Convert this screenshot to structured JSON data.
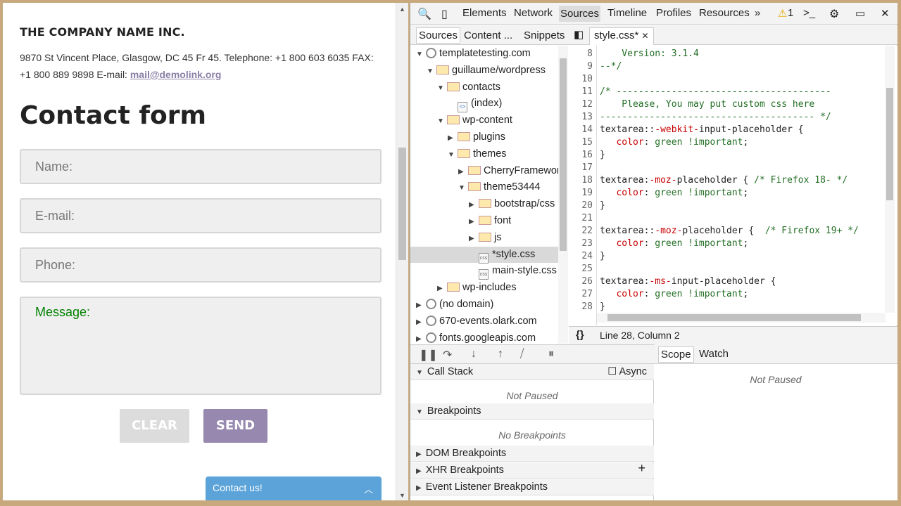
{
  "page": {
    "company": "THE COMPANY NAME INC.",
    "address": "9870 St Vincent Place, Glasgow, DC 45 Fr 45. Telephone: +1 800 603 6035 FAX: +1 800 889 9898 E-mail: ",
    "email": "mail@demolink.org",
    "form_title": "Contact form",
    "name_placeholder": "Name:",
    "email_placeholder": "E-mail:",
    "phone_placeholder": "Phone:",
    "message_placeholder": "Message:",
    "clear_label": "CLEAR",
    "send_label": "SEND",
    "chat_label": "Contact us!"
  },
  "devtools": {
    "tabs": [
      "Elements",
      "Network",
      "Sources",
      "Timeline",
      "Profiles",
      "Resources"
    ],
    "active_tab": "Sources",
    "more": "»",
    "warnings": "1",
    "nav_tabs": [
      "Sources",
      "Content ...",
      "Snippets"
    ],
    "file_tab": "style.css*",
    "tree": [
      {
        "label": "templatetesting.com",
        "type": "globe",
        "depth": 0,
        "tw": "▼"
      },
      {
        "label": "guillaume/wordpress",
        "type": "folder",
        "depth": 1,
        "tw": "▼"
      },
      {
        "label": "contacts",
        "type": "folder",
        "depth": 2,
        "tw": "▼"
      },
      {
        "label": "(index)",
        "type": "file",
        "depth": 3,
        "tw": ""
      },
      {
        "label": "wp-content",
        "type": "folder",
        "depth": 2,
        "tw": "▼"
      },
      {
        "label": "plugins",
        "type": "folder",
        "depth": 3,
        "tw": "▶"
      },
      {
        "label": "themes",
        "type": "folder",
        "depth": 3,
        "tw": "▼"
      },
      {
        "label": "CherryFramewor",
        "type": "folder",
        "depth": 4,
        "tw": "▶"
      },
      {
        "label": "theme53444",
        "type": "folder",
        "depth": 4,
        "tw": "▼"
      },
      {
        "label": "bootstrap/css",
        "type": "folder",
        "depth": 5,
        "tw": "▶"
      },
      {
        "label": "font",
        "type": "folder",
        "depth": 5,
        "tw": "▶"
      },
      {
        "label": "js",
        "type": "folder",
        "depth": 5,
        "tw": "▶"
      },
      {
        "label": "*style.css",
        "type": "css",
        "depth": 5,
        "tw": "",
        "selected": true
      },
      {
        "label": "main-style.css",
        "type": "css",
        "depth": 5,
        "tw": ""
      },
      {
        "label": "wp-includes",
        "type": "folder",
        "depth": 2,
        "tw": "▶"
      },
      {
        "label": "(no domain)",
        "type": "globe",
        "depth": 0,
        "tw": "▶"
      },
      {
        "label": "670-events.olark.com",
        "type": "globe",
        "depth": 0,
        "tw": "▶"
      },
      {
        "label": "fonts.googleapis.com",
        "type": "globe",
        "depth": 0,
        "tw": "▶"
      }
    ],
    "code_lines": [
      {
        "n": "8",
        "t": "    Version: 3.1.4",
        "c": "cm"
      },
      {
        "n": "9",
        "t": "--*/",
        "c": "cm"
      },
      {
        "n": "10",
        "t": "",
        "c": ""
      },
      {
        "n": "11",
        "t": "/* ---------------------------------------",
        "c": "cm"
      },
      {
        "n": "12",
        "t": "    Please, You may put custom css here",
        "c": "cm"
      },
      {
        "n": "13",
        "t": "--------------------------------------- */",
        "c": "cm"
      },
      {
        "n": "14",
        "t": "textarea::-webkit-input-placeholder {",
        "c": "sel1"
      },
      {
        "n": "15",
        "t": "   color: green !important;",
        "c": "decl"
      },
      {
        "n": "16",
        "t": "}",
        "c": ""
      },
      {
        "n": "17",
        "t": "",
        "c": ""
      },
      {
        "n": "18",
        "t": "textarea:-moz-placeholder { /* Firefox 18- */",
        "c": "sel2"
      },
      {
        "n": "19",
        "t": "   color: green !important;",
        "c": "decl"
      },
      {
        "n": "20",
        "t": "}",
        "c": ""
      },
      {
        "n": "21",
        "t": "",
        "c": ""
      },
      {
        "n": "22",
        "t": "textarea::-moz-placeholder {  /* Firefox 19+ */",
        "c": "sel3"
      },
      {
        "n": "23",
        "t": "   color: green !important;",
        "c": "decl"
      },
      {
        "n": "24",
        "t": "}",
        "c": ""
      },
      {
        "n": "25",
        "t": "",
        "c": ""
      },
      {
        "n": "26",
        "t": "textarea:-ms-input-placeholder {",
        "c": "sel4"
      },
      {
        "n": "27",
        "t": "   color: green !important;",
        "c": "decl"
      },
      {
        "n": "28",
        "t": "}",
        "c": ""
      }
    ],
    "cursor": "Line 28, Column 2",
    "call_stack": "Call Stack",
    "async": "Async",
    "not_paused": "Not Paused",
    "breakpoints": "Breakpoints",
    "no_breakpoints": "No Breakpoints",
    "dom_breakpoints": "DOM Breakpoints",
    "xhr_breakpoints": "XHR Breakpoints",
    "event_breakpoints": "Event Listener Breakpoints",
    "scope": "Scope",
    "watch": "Watch",
    "scope_not_paused": "Not Paused"
  }
}
